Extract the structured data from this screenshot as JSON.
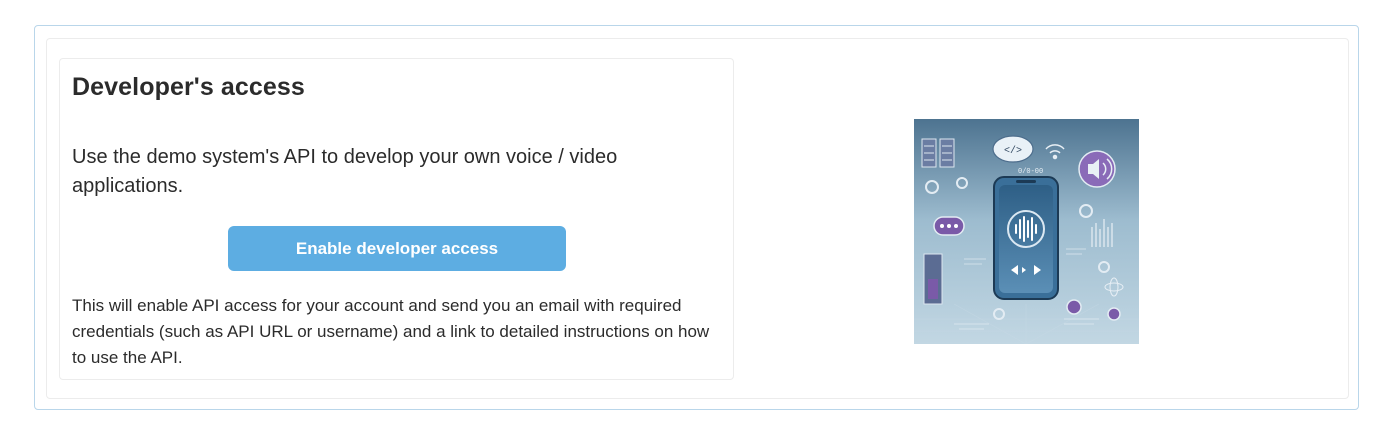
{
  "developer_access": {
    "title": "Developer's access",
    "lead": "Use the demo system's API to develop your own voice / video applications.",
    "enable_button_label": "Enable developer access",
    "note": "This will enable API access for your account and send you an email with required credentials (such as API URL or username) and a link to detailed instructions on how to use the API."
  },
  "illustration": {
    "icon": "phone-audio-api-illustration",
    "code_badge": "</>",
    "code_text": "0/0-00",
    "accent_color": "#7a5aa8",
    "button_color": "#5dade2"
  }
}
